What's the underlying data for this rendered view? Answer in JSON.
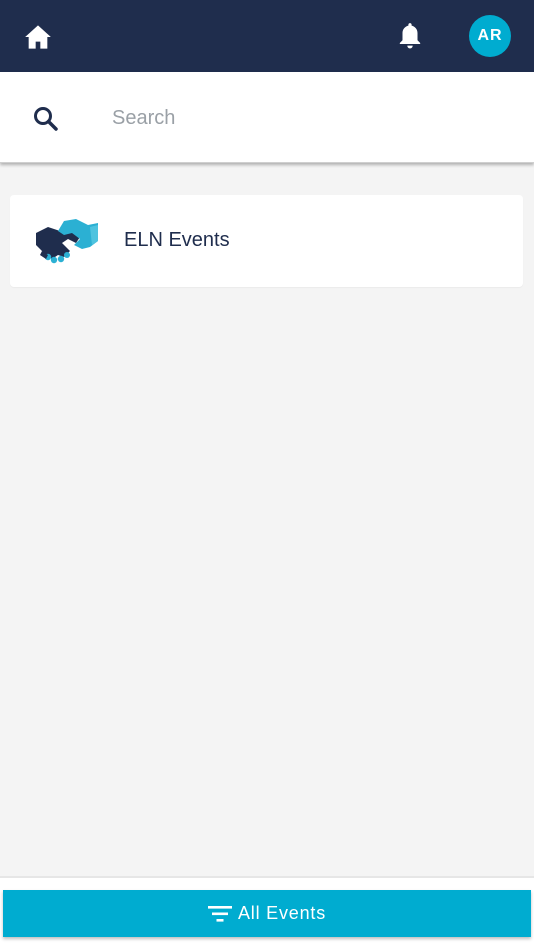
{
  "topbar": {
    "home_icon": "home-icon",
    "notification_icon": "bell-icon",
    "avatar_initials": "AR",
    "background_color": "#1f2d4d",
    "avatar_color": "#00acd0"
  },
  "search": {
    "icon": "search-icon",
    "placeholder": "Search",
    "value": ""
  },
  "events": [
    {
      "title": "ELN Events",
      "icon": "handshake-icon"
    }
  ],
  "bottom": {
    "filter_icon": "filter-icon",
    "filter_label": "All Events",
    "button_color": "#00acd0"
  }
}
